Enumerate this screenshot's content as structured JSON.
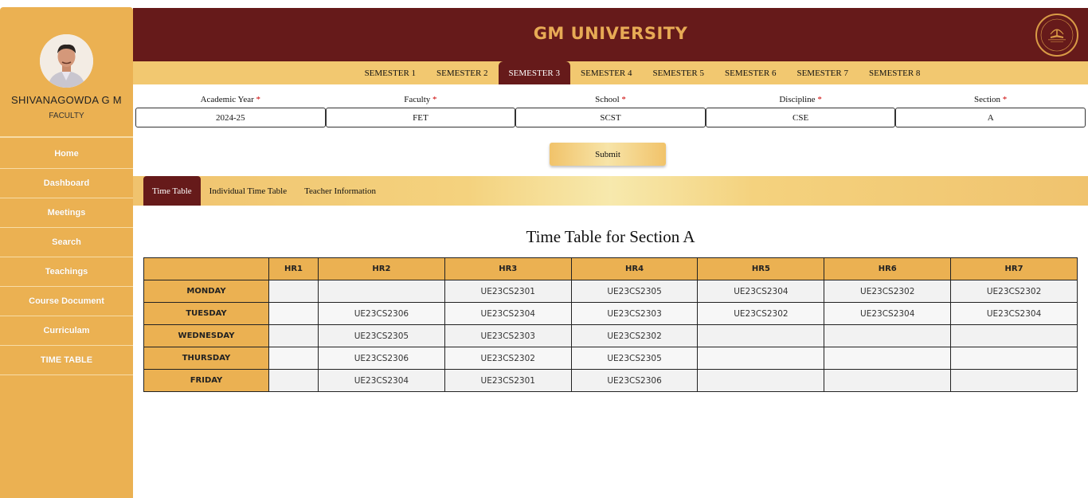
{
  "profile": {
    "name": "SHIVANAGOWDA G M",
    "role": "FACULTY"
  },
  "sidebar": {
    "items": [
      {
        "label": "Home"
      },
      {
        "label": "Dashboard"
      },
      {
        "label": "Meetings"
      },
      {
        "label": "Search"
      },
      {
        "label": "Teachings"
      },
      {
        "label": "Course Document"
      },
      {
        "label": "Curriculam"
      },
      {
        "label": "TIME TABLE"
      }
    ]
  },
  "header": {
    "title": "GM UNIVERSITY"
  },
  "semesters": {
    "tabs": [
      "SEMESTER 1",
      "SEMESTER 2",
      "SEMESTER 3",
      "SEMESTER 4",
      "SEMESTER 5",
      "SEMESTER 6",
      "SEMESTER 7",
      "SEMESTER 8"
    ],
    "active": "SEMESTER 3"
  },
  "filters": {
    "academic_year": {
      "label": "Academic Year",
      "value": "2024-25"
    },
    "faculty": {
      "label": "Faculty",
      "value": "FET"
    },
    "school": {
      "label": "School",
      "value": "SCST"
    },
    "discipline": {
      "label": "Discipline",
      "value": "CSE"
    },
    "section": {
      "label": "Section",
      "value": "A"
    },
    "required_mark": "*"
  },
  "submit_label": "Submit",
  "subtabs": {
    "time_table": "Time Table",
    "individual": "Individual Time Table",
    "teacher_info": "Teacher Information"
  },
  "timetable": {
    "title": "Time Table for Section A",
    "headers": [
      "",
      "HR1",
      "HR2",
      "HR3",
      "HR4",
      "HR5",
      "HR6",
      "HR7"
    ],
    "rows": [
      {
        "day": "MONDAY",
        "cells": [
          "",
          "",
          "UE23CS2301",
          "UE23CS2305",
          "UE23CS2304",
          "UE23CS2302",
          "UE23CS2302"
        ]
      },
      {
        "day": "TUESDAY",
        "cells": [
          "",
          "UE23CS2306",
          "UE23CS2304",
          "UE23CS2303",
          "UE23CS2302",
          "UE23CS2304",
          "UE23CS2304"
        ]
      },
      {
        "day": "WEDNESDAY",
        "cells": [
          "",
          "UE23CS2305",
          "UE23CS2303",
          "UE23CS2302",
          "",
          "",
          ""
        ]
      },
      {
        "day": "THURSDAY",
        "cells": [
          "",
          "UE23CS2306",
          "UE23CS2302",
          "UE23CS2305",
          "",
          "",
          ""
        ]
      },
      {
        "day": "FRIDAY",
        "cells": [
          "",
          "UE23CS2304",
          "UE23CS2301",
          "UE23CS2306",
          "",
          "",
          ""
        ]
      }
    ]
  },
  "colors": {
    "maroon": "#661a1a",
    "gold": "#ebb152",
    "light_gold": "#f2c870"
  }
}
